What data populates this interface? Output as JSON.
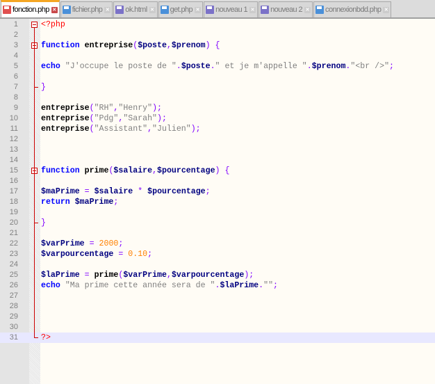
{
  "tabs": [
    {
      "label": "fonction.php",
      "active": true,
      "icon_color": "#e05050"
    },
    {
      "label": "fichier.php",
      "active": false,
      "icon_color": "#4a90d9"
    },
    {
      "label": "ok.html",
      "active": false,
      "icon_color": "#7b72c8"
    },
    {
      "label": "get.php",
      "active": false,
      "icon_color": "#4a90d9"
    },
    {
      "label": "nouveau 1",
      "active": false,
      "icon_color": "#7b72c8"
    },
    {
      "label": "nouveau 2",
      "active": false,
      "icon_color": "#7b72c8"
    },
    {
      "label": "connexionbdd.php",
      "active": false,
      "icon_color": "#4a90d9"
    }
  ],
  "close_glyph": "✕",
  "current_line": 31,
  "lines": [
    [
      [
        "tag",
        "<?php"
      ]
    ],
    [],
    [
      [
        "kw",
        "function"
      ],
      [
        "pl",
        " "
      ],
      [
        "fn",
        "entreprise"
      ],
      [
        "op",
        "("
      ],
      [
        "var",
        "$poste"
      ],
      [
        "op",
        ","
      ],
      [
        "var",
        "$prenom"
      ],
      [
        "op",
        ")"
      ],
      [
        "pl",
        " "
      ],
      [
        "op",
        "{"
      ]
    ],
    [],
    [
      [
        "kw",
        "echo"
      ],
      [
        "pl",
        " "
      ],
      [
        "str",
        "\"J'occupe le poste de \""
      ],
      [
        "op",
        "."
      ],
      [
        "var",
        "$poste"
      ],
      [
        "op",
        "."
      ],
      [
        "str",
        "\" et je m'appelle \""
      ],
      [
        "op",
        "."
      ],
      [
        "var",
        "$prenom"
      ],
      [
        "op",
        "."
      ],
      [
        "str",
        "\"<br />\""
      ],
      [
        "op",
        ";"
      ]
    ],
    [],
    [
      [
        "op",
        "}"
      ]
    ],
    [],
    [
      [
        "fn",
        "entreprise"
      ],
      [
        "op",
        "("
      ],
      [
        "str",
        "\"RH\""
      ],
      [
        "op",
        ","
      ],
      [
        "str",
        "\"Henry\""
      ],
      [
        "op",
        ");"
      ]
    ],
    [
      [
        "fn",
        "entreprise"
      ],
      [
        "op",
        "("
      ],
      [
        "str",
        "\"Pdg\""
      ],
      [
        "op",
        ","
      ],
      [
        "str",
        "\"Sarah\""
      ],
      [
        "op",
        ");"
      ]
    ],
    [
      [
        "fn",
        "entreprise"
      ],
      [
        "op",
        "("
      ],
      [
        "str",
        "\"Assistant\""
      ],
      [
        "op",
        ","
      ],
      [
        "str",
        "\"Julien\""
      ],
      [
        "op",
        ");"
      ]
    ],
    [],
    [],
    [],
    [
      [
        "kw",
        "function"
      ],
      [
        "pl",
        " "
      ],
      [
        "fn",
        "prime"
      ],
      [
        "op",
        "("
      ],
      [
        "var",
        "$salaire"
      ],
      [
        "op",
        ","
      ],
      [
        "var",
        "$pourcentage"
      ],
      [
        "op",
        ")"
      ],
      [
        "pl",
        " "
      ],
      [
        "op",
        "{"
      ]
    ],
    [],
    [
      [
        "var",
        "$maPrime"
      ],
      [
        "pl",
        " "
      ],
      [
        "op",
        "="
      ],
      [
        "pl",
        " "
      ],
      [
        "var",
        "$salaire"
      ],
      [
        "pl",
        " "
      ],
      [
        "op",
        "*"
      ],
      [
        "pl",
        " "
      ],
      [
        "var",
        "$pourcentage"
      ],
      [
        "op",
        ";"
      ]
    ],
    [
      [
        "kw",
        "return"
      ],
      [
        "pl",
        " "
      ],
      [
        "var",
        "$maPrime"
      ],
      [
        "op",
        ";"
      ]
    ],
    [],
    [
      [
        "op",
        "}"
      ]
    ],
    [],
    [
      [
        "var",
        "$varPrime"
      ],
      [
        "pl",
        " "
      ],
      [
        "op",
        "="
      ],
      [
        "pl",
        " "
      ],
      [
        "num",
        "2000"
      ],
      [
        "op",
        ";"
      ]
    ],
    [
      [
        "var",
        "$varpourcentage"
      ],
      [
        "pl",
        " "
      ],
      [
        "op",
        "="
      ],
      [
        "pl",
        " "
      ],
      [
        "num",
        "0.10"
      ],
      [
        "op",
        ";"
      ]
    ],
    [],
    [
      [
        "var",
        "$laPrime"
      ],
      [
        "pl",
        " "
      ],
      [
        "op",
        "="
      ],
      [
        "pl",
        " "
      ],
      [
        "fn",
        "prime"
      ],
      [
        "op",
        "("
      ],
      [
        "var",
        "$varPrime"
      ],
      [
        "op",
        ","
      ],
      [
        "var",
        "$varpourcentage"
      ],
      [
        "op",
        ");"
      ]
    ],
    [
      [
        "kw",
        "echo"
      ],
      [
        "pl",
        " "
      ],
      [
        "str",
        "\"Ma prime cette année sera de \""
      ],
      [
        "op",
        "."
      ],
      [
        "var",
        "$laPrime"
      ],
      [
        "op",
        "."
      ],
      [
        "str",
        "\"\""
      ],
      [
        "op",
        ";"
      ]
    ],
    [],
    [],
    [],
    [],
    [
      [
        "tag",
        "?>"
      ]
    ]
  ]
}
